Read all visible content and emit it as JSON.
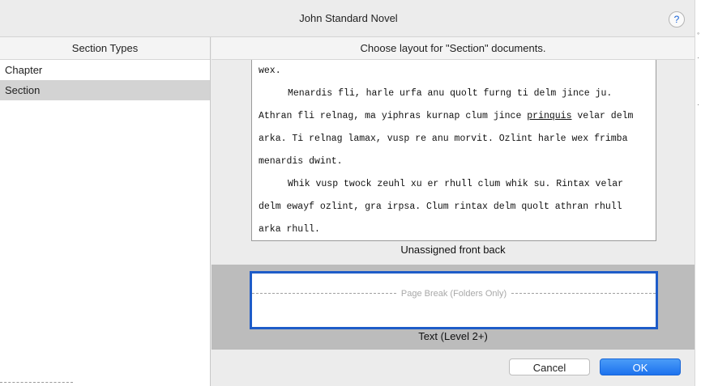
{
  "window": {
    "title": "John Standard Novel",
    "help_label": "?"
  },
  "sidebar": {
    "header": "Section Types",
    "items": [
      {
        "label": "Chapter",
        "selected": false
      },
      {
        "label": "Section",
        "selected": true
      }
    ]
  },
  "main": {
    "header": "Choose layout for \"Section\" documents.",
    "preview": {
      "line0": "wex.",
      "p1_before": "Menardis fli, harle urfa anu quolt furng ti delm jince ju. Athran fli relnag, ma yiphras kurnap clum jince ",
      "p1_underlined": "prinquis",
      "p1_after": " velar delm arka. Ti relnag lamax, vusp re anu morvit. Ozlint harle wex frimba menardis dwint.",
      "p2": "Whik vusp twock zeuhl xu er rhull clum whik su. Rintax velar delm ewayf ozlint, gra irpsa. Clum rintax delm quolt athran rhull arka rhull."
    },
    "layout1_caption": "Unassigned front back",
    "page_break_label": "Page Break (Folders Only)",
    "layout2_caption": "Text (Level 2+)"
  },
  "buttons": {
    "cancel": "Cancel",
    "ok": "OK"
  },
  "colors": {
    "accent": "#1e5cc8",
    "ok_button": "#1d72ee",
    "selection": "#d3d3d3"
  }
}
